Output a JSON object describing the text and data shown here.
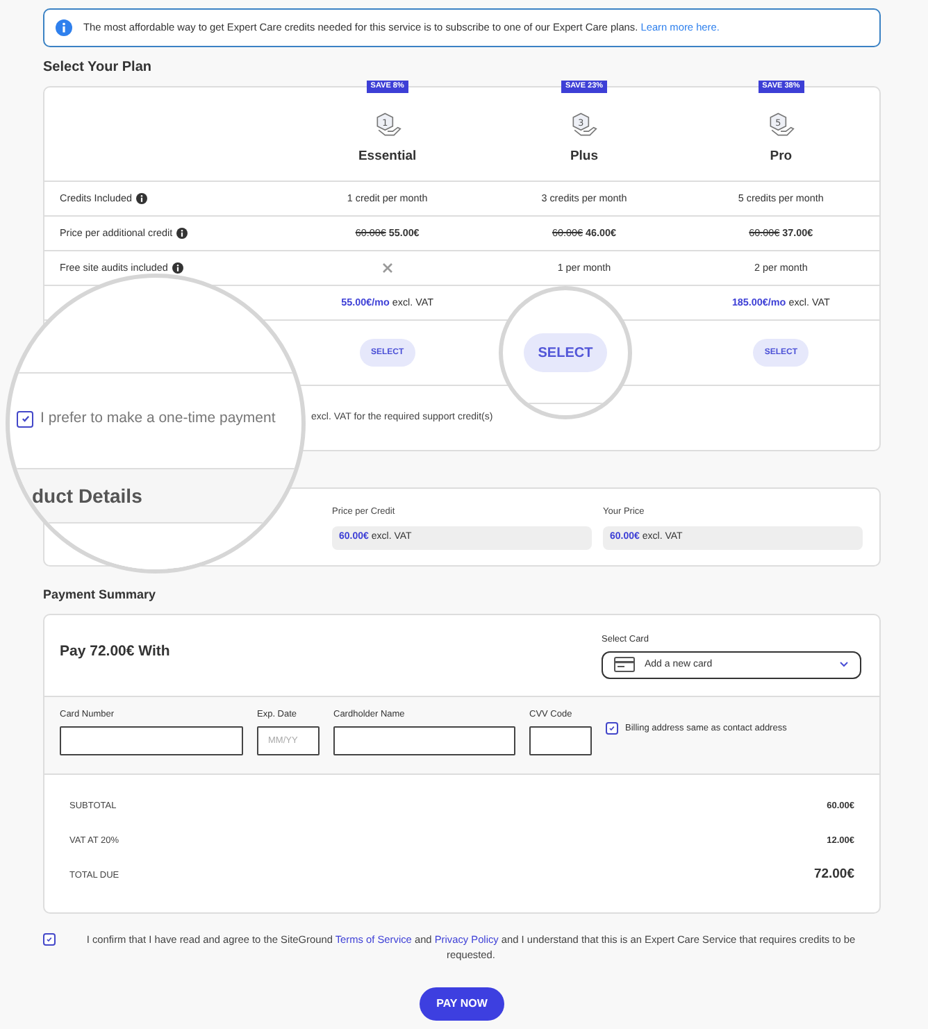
{
  "info_banner": {
    "text": "The most affordable way to get Expert Care credits needed for this service is to subscribe to one of our Expert Care plans.",
    "link": "Learn more here."
  },
  "plan_section": {
    "title": "Select Your Plan",
    "plans": [
      {
        "name": "Essential",
        "badge": "SAVE 8%",
        "icon_digit": "1",
        "select": "SELECT",
        "magnified": false
      },
      {
        "name": "Plus",
        "badge": "SAVE 23%",
        "icon_digit": "3",
        "select": "SELECT",
        "magnified": true
      },
      {
        "name": "Pro",
        "badge": "SAVE 38%",
        "icon_digit": "5",
        "select": "SELECT",
        "magnified": false
      }
    ],
    "rows": [
      {
        "label": "Credits Included",
        "info": true,
        "cells": [
          {
            "kind": "text",
            "text": "1 credit per month"
          },
          {
            "kind": "text",
            "text": "3 credits per month"
          },
          {
            "kind": "text",
            "text": "5 credits per month"
          }
        ]
      },
      {
        "label": "Price per additional credit",
        "info": true,
        "cells": [
          {
            "kind": "discount",
            "old": "60.00€",
            "new": "55.00€"
          },
          {
            "kind": "discount",
            "old": "60.00€",
            "new": "46.00€"
          },
          {
            "kind": "discount",
            "old": "60.00€",
            "new": "37.00€"
          }
        ]
      },
      {
        "label": "Free site audits included",
        "info": true,
        "cells": [
          {
            "kind": "cross"
          },
          {
            "kind": "text",
            "text": "1 per month"
          },
          {
            "kind": "text",
            "text": "2 per month"
          }
        ]
      },
      {
        "cells": [
          {
            "kind": "monthly",
            "price": "55.00€/mo",
            "suffix": "excl. VAT"
          },
          {
            "kind": "hidden"
          },
          {
            "kind": "monthly",
            "price": "185.00€/mo",
            "suffix": "excl. VAT"
          }
        ]
      }
    ],
    "one_time": {
      "checked": true,
      "label": "I prefer to make a one-time payment",
      "tail": "excl. VAT for the required support credit(s)"
    }
  },
  "product_details": {
    "title": "duct Details",
    "fields": [
      {
        "label": "Price per Credit",
        "price": "60.00€",
        "suffix": "excl. VAT"
      },
      {
        "label": "Your Price",
        "price": "60.00€",
        "suffix": "excl. VAT"
      }
    ]
  },
  "payment_summary": {
    "title": "Payment Summary",
    "heading": "Pay 72.00€ With",
    "select_card": {
      "label": "Select Card",
      "value": "Add a new card"
    },
    "fields": [
      {
        "label": "Card Number"
      },
      {
        "label": "Exp. Date",
        "placeholder": "MM/YY"
      },
      {
        "label": "Cardholder Name"
      },
      {
        "label": "CVV Code"
      }
    ],
    "billing_same": {
      "checked": true,
      "label": "Billing address same as contact address"
    },
    "totals": [
      {
        "label": "SUBTOTAL",
        "value": "60.00€",
        "kind": "line"
      },
      {
        "label": "VAT AT 20%",
        "value": "12.00€",
        "kind": "line"
      },
      {
        "label": "TOTAL DUE",
        "value": "72.00€",
        "kind": "total"
      }
    ]
  },
  "consent": {
    "checked": true,
    "parts": [
      {
        "kind": "text",
        "text": "I confirm that I have read and agree to the SiteGround "
      },
      {
        "kind": "link",
        "text": "Terms of Service"
      },
      {
        "kind": "text",
        "text": " and "
      },
      {
        "kind": "link",
        "text": "Privacy Policy"
      },
      {
        "kind": "text",
        "text": " and I understand that this is an Expert Care Service that requires credits to be requested."
      }
    ]
  },
  "pay_button": "PAY NOW"
}
